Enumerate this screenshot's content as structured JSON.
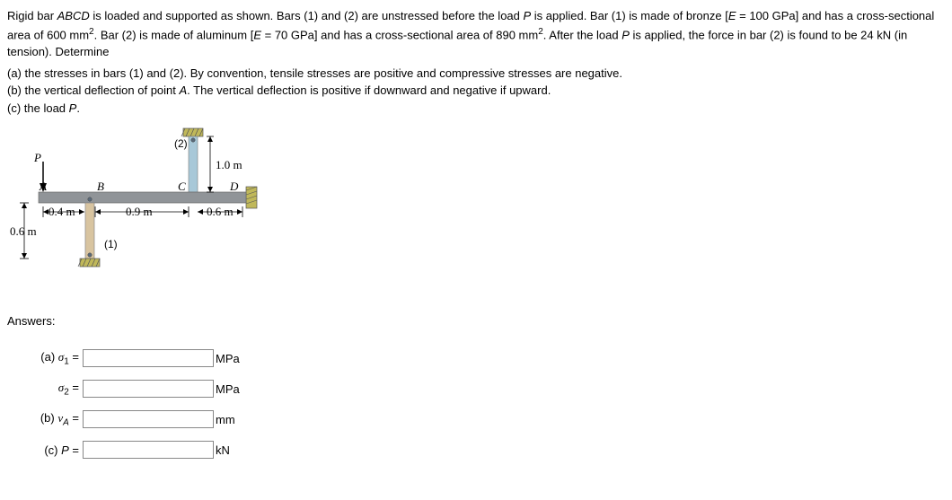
{
  "problem": {
    "paragraph1_part1": "Rigid bar ",
    "paragraph1_abcd": "ABCD",
    "paragraph1_part2": " is loaded and supported as shown. Bars (1) and (2) are unstressed before the load ",
    "paragraph1_p1": "P",
    "paragraph1_part3": " is applied. Bar (1) is made of bronze [",
    "paragraph1_e1": "E",
    "paragraph1_part4": " = 100 GPa] and has a cross-sectional area of 600 mm",
    "paragraph1_sup1": "2",
    "paragraph1_part5": ". Bar (2) is made of aluminum [",
    "paragraph1_e2": "E",
    "paragraph1_part6": " = 70 GPa] and has a cross-sectional area of 890 mm",
    "paragraph1_sup2": "2",
    "paragraph1_part7": ". After the load ",
    "paragraph1_p2": "P",
    "paragraph1_part8": " is applied, the force in bar (2) is found to be 24 kN (in tension). Determine"
  },
  "subquestions": {
    "a": "(a) the stresses in bars (1) and (2). By convention, tensile stresses are positive and compressive stresses are negative.",
    "b_part1": "(b) the vertical deflection of point ",
    "b_a": "A",
    "b_part2": ". The vertical deflection is positive if downward and negative if upward.",
    "c_part1": "(c) the load ",
    "c_p": "P",
    "c_part2": "."
  },
  "diagram": {
    "label_p": "P",
    "label_a": "A",
    "label_b": "B",
    "label_c": "C",
    "label_d": "D",
    "label_bar1": "(1)",
    "label_bar2": "(2)",
    "dim_04m": "0.4 m",
    "dim_09m": "0.9 m",
    "dim_06m": "0.6 m",
    "dim_06m_left": "0.6 m",
    "dim_10m": "1.0 m"
  },
  "answers": {
    "heading": "Answers:",
    "a_label": "(a) ",
    "sigma1": "σ",
    "sigma1_sub": "1",
    "sigma1_equals": " = ",
    "sigma2": "σ",
    "sigma2_sub": "2",
    "sigma2_equals": " = ",
    "b_label": "(b) ",
    "va": "v",
    "va_sub": "A",
    "va_equals": " = ",
    "c_label": "(c) ",
    "p": "P",
    "p_equals": " = ",
    "unit_mpa": "MPa",
    "unit_mm": "mm",
    "unit_kn": "kN"
  }
}
